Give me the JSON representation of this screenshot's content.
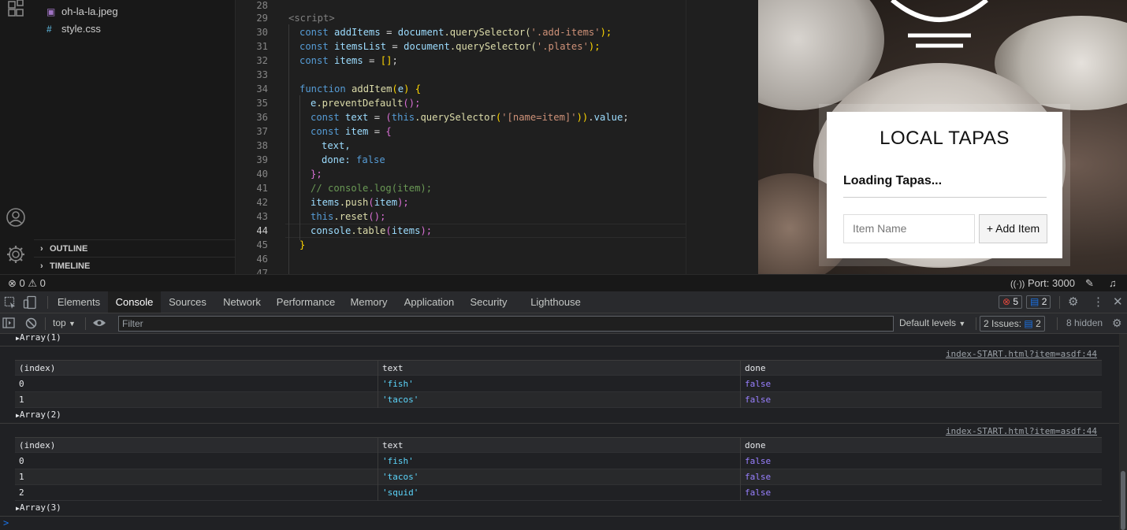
{
  "sidebar": {
    "files": [
      {
        "name": "oh-la-la.jpeg",
        "icon": "image-icon"
      },
      {
        "name": "style.css",
        "icon": "css-icon"
      }
    ],
    "sections": [
      "OUTLINE",
      "TIMELINE"
    ]
  },
  "editor": {
    "lines": [
      {
        "n": "28"
      },
      {
        "n": "29"
      },
      {
        "n": "30"
      },
      {
        "n": "31"
      },
      {
        "n": "32"
      },
      {
        "n": "33"
      },
      {
        "n": "34"
      },
      {
        "n": "35"
      },
      {
        "n": "36"
      },
      {
        "n": "37"
      },
      {
        "n": "38"
      },
      {
        "n": "39"
      },
      {
        "n": "40"
      },
      {
        "n": "41"
      },
      {
        "n": "42"
      },
      {
        "n": "43"
      },
      {
        "n": "44"
      },
      {
        "n": "45"
      },
      {
        "n": "46"
      },
      {
        "n": "47"
      }
    ],
    "code": {
      "l29": "<script>",
      "l30": [
        "const",
        "addItems",
        "=",
        "document",
        ".querySelector(",
        "'.add-items'",
        ");"
      ],
      "l31": [
        "const",
        "itemsList",
        "=",
        "document",
        ".querySelector(",
        "'.plates'",
        ");"
      ],
      "l32": [
        "const",
        "items",
        "=",
        "[]",
        ";"
      ],
      "l34": [
        "function",
        "addItem",
        "(",
        "e",
        ")",
        " {"
      ],
      "l35": [
        "e",
        ".preventDefault",
        "();"
      ],
      "l36": [
        "const",
        "text",
        "=",
        "(",
        "this",
        ".querySelector",
        "(",
        "'[name=item]'",
        "))",
        ".",
        "value",
        ";"
      ],
      "l37": [
        "const",
        "item",
        "=",
        "{"
      ],
      "l38": "text,",
      "l39": [
        "done:",
        "false"
      ],
      "l40": "};",
      "l41": "// console.log(item);",
      "l42": [
        "items",
        ".push",
        "(",
        "item",
        ");"
      ],
      "l43": [
        "this",
        ".reset",
        "();"
      ],
      "l44": [
        "console",
        ".table",
        "(",
        "items",
        ");"
      ],
      "l45": "}"
    }
  },
  "preview": {
    "title": "LOCAL TAPAS",
    "loading": "Loading Tapas...",
    "input_placeholder": "Item Name",
    "add_button": "+ Add Item"
  },
  "statusbar": {
    "errors": "0",
    "warnings": "0",
    "port": "Port: 3000"
  },
  "devtools": {
    "tabs": [
      "Elements",
      "Console",
      "Sources",
      "Network",
      "Performance",
      "Memory",
      "Application",
      "Security",
      "Lighthouse"
    ],
    "active_tab": "Console",
    "error_count": "5",
    "message_count": "2",
    "context": "top",
    "filter_placeholder": "Filter",
    "levels": "Default levels",
    "issues_label": "2 Issues:",
    "issues_count": "2",
    "hidden": "8 hidden"
  },
  "console": {
    "top_array": "Array(1)",
    "tables": [
      {
        "source": "index-START.html?item=asdf:44",
        "headers": [
          "(index)",
          "text",
          "done"
        ],
        "rows": [
          [
            "0",
            "'fish'",
            "false"
          ],
          [
            "1",
            "'tacos'",
            "false"
          ]
        ],
        "array_label": "Array(2)"
      },
      {
        "source": "index-START.html?item=asdf:44",
        "headers": [
          "(index)",
          "text",
          "done"
        ],
        "rows": [
          [
            "0",
            "'fish'",
            "false"
          ],
          [
            "1",
            "'tacos'",
            "false"
          ],
          [
            "2",
            "'squid'",
            "false"
          ]
        ],
        "array_label": "Array(3)"
      }
    ],
    "prompt": ">"
  },
  "colors": {
    "accent_blue": "#1a73e8",
    "error_red": "#e0473c",
    "string": "#5cd5fb",
    "boolean": "#9980ff"
  }
}
